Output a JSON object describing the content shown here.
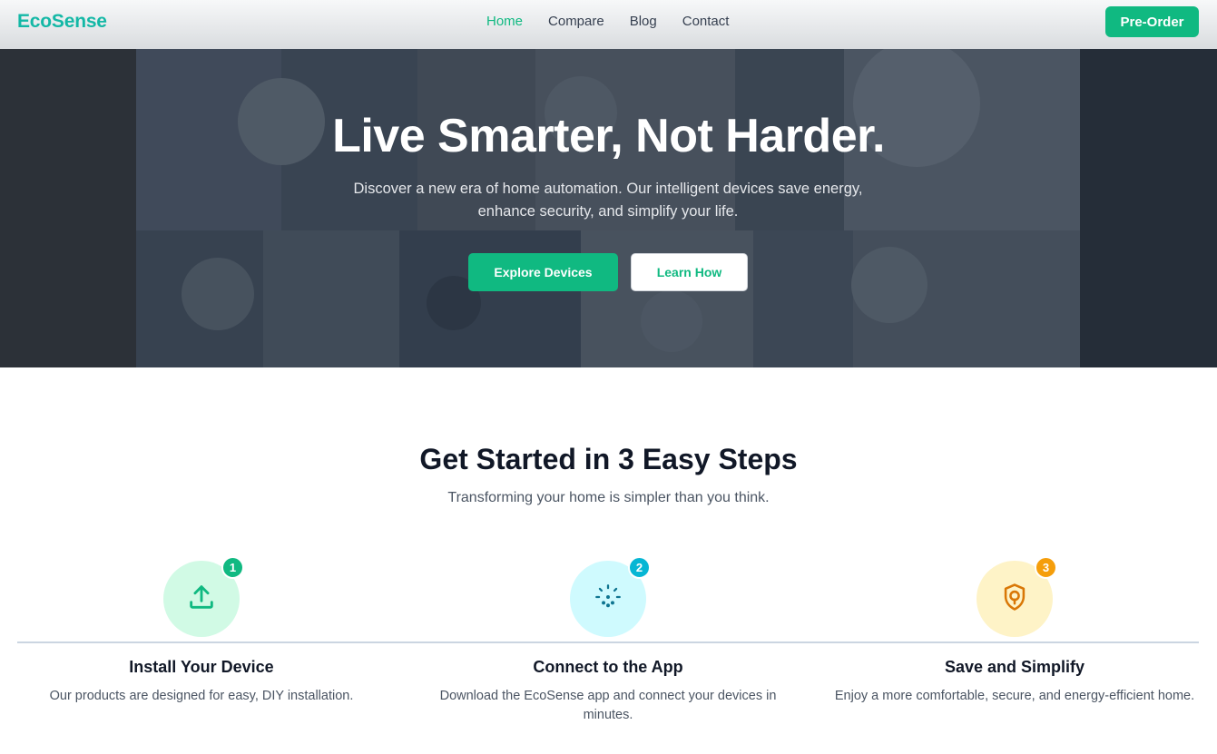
{
  "nav": {
    "logo": "EcoSense",
    "links": [
      "Home",
      "Compare",
      "Blog",
      "Contact"
    ],
    "active": "Home",
    "cta": "Pre-Order"
  },
  "hero": {
    "title": "Live Smarter, Not Harder.",
    "subtitle": "Discover a new era of home automation. Our intelligent devices save energy, enhance security, and simplify your life.",
    "primary_button": "Explore Devices",
    "secondary_button": "Learn How"
  },
  "steps": {
    "title": "Get Started in 3 Easy Steps",
    "subtitle": "Transforming your home is simpler than you think.",
    "items": [
      {
        "number": "1",
        "title": "Install Your Device",
        "text": "Our products are designed for easy, DIY installation.",
        "icon": "upload-icon",
        "color": "#10b981",
        "bg": "#d1fae5"
      },
      {
        "number": "2",
        "title": "Connect to the App",
        "text": "Download the EcoSense app and connect your devices in minutes.",
        "icon": "loading-dial-icon",
        "color": "#06b6d4",
        "bg": "#cffafe"
      },
      {
        "number": "3",
        "title": "Save and Simplify",
        "text": "Enjoy a more comfortable, secure, and energy-efficient home.",
        "icon": "shield-icon",
        "color": "#f59e0b",
        "bg": "#fef3c7"
      }
    ]
  },
  "colors": {
    "brand": "#10b981",
    "logo": "#14b8a6"
  }
}
